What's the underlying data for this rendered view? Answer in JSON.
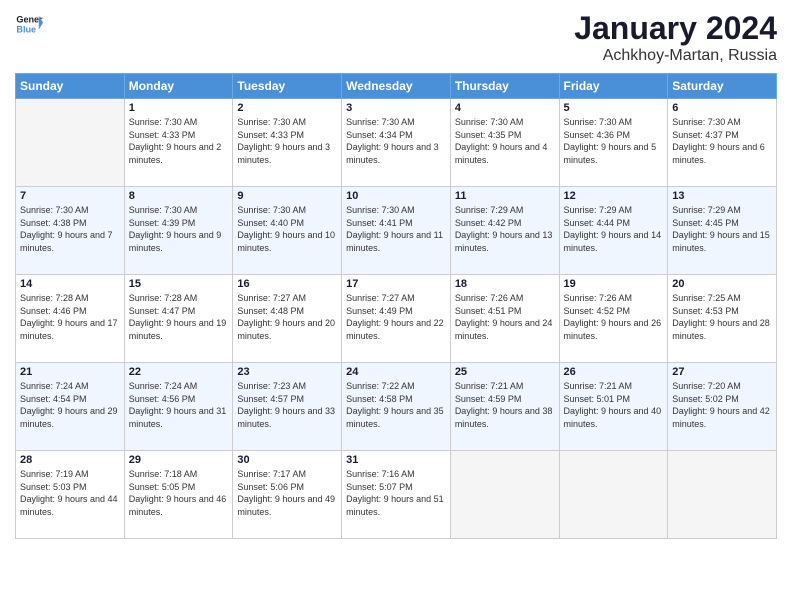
{
  "header": {
    "logo_general": "General",
    "logo_blue": "Blue",
    "month_title": "January 2024",
    "location": "Achkhoy-Martan, Russia"
  },
  "days_of_week": [
    "Sunday",
    "Monday",
    "Tuesday",
    "Wednesday",
    "Thursday",
    "Friday",
    "Saturday"
  ],
  "weeks": [
    [
      {
        "day": "",
        "sunrise": "",
        "sunset": "",
        "daylight": ""
      },
      {
        "day": "1",
        "sunrise": "7:30 AM",
        "sunset": "4:33 PM",
        "daylight": "9 hours and 2 minutes."
      },
      {
        "day": "2",
        "sunrise": "7:30 AM",
        "sunset": "4:33 PM",
        "daylight": "9 hours and 3 minutes."
      },
      {
        "day": "3",
        "sunrise": "7:30 AM",
        "sunset": "4:34 PM",
        "daylight": "9 hours and 3 minutes."
      },
      {
        "day": "4",
        "sunrise": "7:30 AM",
        "sunset": "4:35 PM",
        "daylight": "9 hours and 4 minutes."
      },
      {
        "day": "5",
        "sunrise": "7:30 AM",
        "sunset": "4:36 PM",
        "daylight": "9 hours and 5 minutes."
      },
      {
        "day": "6",
        "sunrise": "7:30 AM",
        "sunset": "4:37 PM",
        "daylight": "9 hours and 6 minutes."
      }
    ],
    [
      {
        "day": "7",
        "sunrise": "7:30 AM",
        "sunset": "4:38 PM",
        "daylight": "9 hours and 7 minutes."
      },
      {
        "day": "8",
        "sunrise": "7:30 AM",
        "sunset": "4:39 PM",
        "daylight": "9 hours and 9 minutes."
      },
      {
        "day": "9",
        "sunrise": "7:30 AM",
        "sunset": "4:40 PM",
        "daylight": "9 hours and 10 minutes."
      },
      {
        "day": "10",
        "sunrise": "7:30 AM",
        "sunset": "4:41 PM",
        "daylight": "9 hours and 11 minutes."
      },
      {
        "day": "11",
        "sunrise": "7:29 AM",
        "sunset": "4:42 PM",
        "daylight": "9 hours and 13 minutes."
      },
      {
        "day": "12",
        "sunrise": "7:29 AM",
        "sunset": "4:44 PM",
        "daylight": "9 hours and 14 minutes."
      },
      {
        "day": "13",
        "sunrise": "7:29 AM",
        "sunset": "4:45 PM",
        "daylight": "9 hours and 15 minutes."
      }
    ],
    [
      {
        "day": "14",
        "sunrise": "7:28 AM",
        "sunset": "4:46 PM",
        "daylight": "9 hours and 17 minutes."
      },
      {
        "day": "15",
        "sunrise": "7:28 AM",
        "sunset": "4:47 PM",
        "daylight": "9 hours and 19 minutes."
      },
      {
        "day": "16",
        "sunrise": "7:27 AM",
        "sunset": "4:48 PM",
        "daylight": "9 hours and 20 minutes."
      },
      {
        "day": "17",
        "sunrise": "7:27 AM",
        "sunset": "4:49 PM",
        "daylight": "9 hours and 22 minutes."
      },
      {
        "day": "18",
        "sunrise": "7:26 AM",
        "sunset": "4:51 PM",
        "daylight": "9 hours and 24 minutes."
      },
      {
        "day": "19",
        "sunrise": "7:26 AM",
        "sunset": "4:52 PM",
        "daylight": "9 hours and 26 minutes."
      },
      {
        "day": "20",
        "sunrise": "7:25 AM",
        "sunset": "4:53 PM",
        "daylight": "9 hours and 28 minutes."
      }
    ],
    [
      {
        "day": "21",
        "sunrise": "7:24 AM",
        "sunset": "4:54 PM",
        "daylight": "9 hours and 29 minutes."
      },
      {
        "day": "22",
        "sunrise": "7:24 AM",
        "sunset": "4:56 PM",
        "daylight": "9 hours and 31 minutes."
      },
      {
        "day": "23",
        "sunrise": "7:23 AM",
        "sunset": "4:57 PM",
        "daylight": "9 hours and 33 minutes."
      },
      {
        "day": "24",
        "sunrise": "7:22 AM",
        "sunset": "4:58 PM",
        "daylight": "9 hours and 35 minutes."
      },
      {
        "day": "25",
        "sunrise": "7:21 AM",
        "sunset": "4:59 PM",
        "daylight": "9 hours and 38 minutes."
      },
      {
        "day": "26",
        "sunrise": "7:21 AM",
        "sunset": "5:01 PM",
        "daylight": "9 hours and 40 minutes."
      },
      {
        "day": "27",
        "sunrise": "7:20 AM",
        "sunset": "5:02 PM",
        "daylight": "9 hours and 42 minutes."
      }
    ],
    [
      {
        "day": "28",
        "sunrise": "7:19 AM",
        "sunset": "5:03 PM",
        "daylight": "9 hours and 44 minutes."
      },
      {
        "day": "29",
        "sunrise": "7:18 AM",
        "sunset": "5:05 PM",
        "daylight": "9 hours and 46 minutes."
      },
      {
        "day": "30",
        "sunrise": "7:17 AM",
        "sunset": "5:06 PM",
        "daylight": "9 hours and 49 minutes."
      },
      {
        "day": "31",
        "sunrise": "7:16 AM",
        "sunset": "5:07 PM",
        "daylight": "9 hours and 51 minutes."
      },
      {
        "day": "",
        "sunrise": "",
        "sunset": "",
        "daylight": ""
      },
      {
        "day": "",
        "sunrise": "",
        "sunset": "",
        "daylight": ""
      },
      {
        "day": "",
        "sunrise": "",
        "sunset": "",
        "daylight": ""
      }
    ]
  ],
  "labels": {
    "sunrise": "Sunrise:",
    "sunset": "Sunset:",
    "daylight": "Daylight:"
  }
}
